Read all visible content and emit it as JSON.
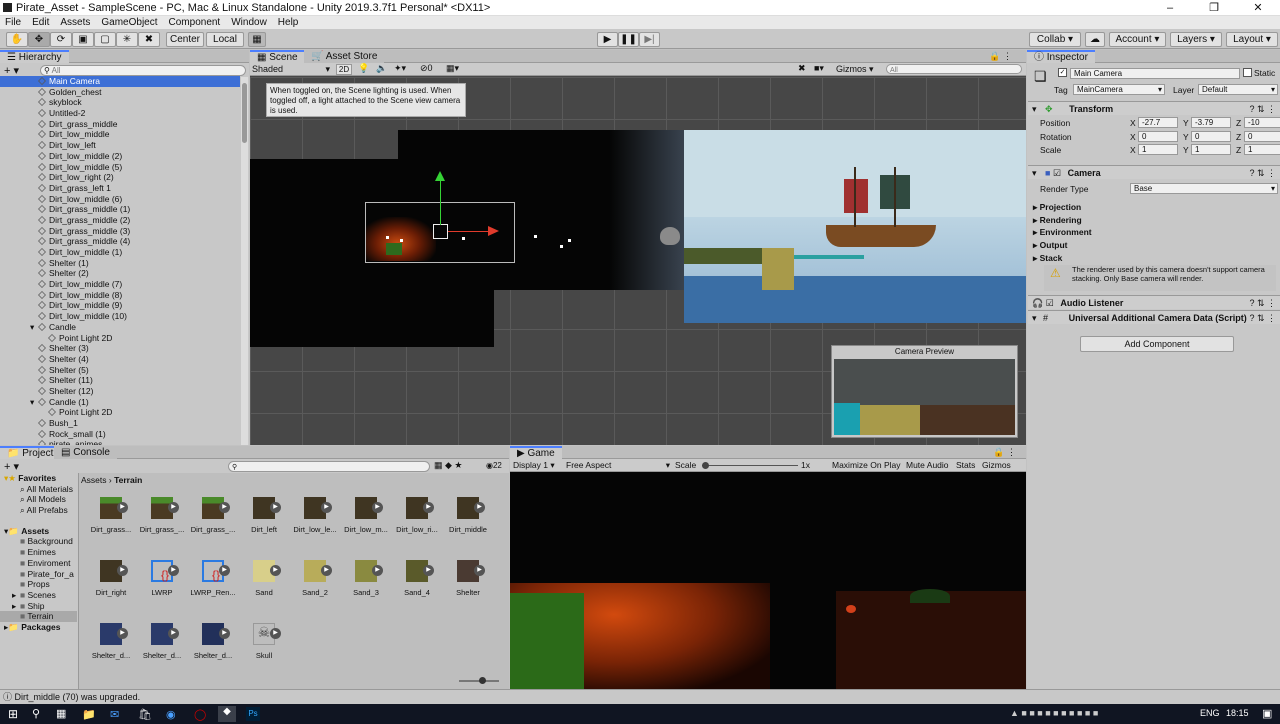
{
  "window": {
    "title": "Pirate_Asset - SampleScene - PC, Mac & Linux Standalone - Unity 2019.3.7f1 Personal* <DX11>"
  },
  "menu": [
    "File",
    "Edit",
    "Assets",
    "GameObject",
    "Component",
    "Window",
    "Help"
  ],
  "toolbar": {
    "center": "Center",
    "local": "Local",
    "collab": "Collab",
    "account": "Account",
    "layers": "Layers",
    "layout": "Layout"
  },
  "hierarchy": {
    "title": "Hierarchy",
    "search_placeholder": "All",
    "items": [
      {
        "label": "Main Camera",
        "indent": 1,
        "selected": true
      },
      {
        "label": "Golden_chest",
        "indent": 1
      },
      {
        "label": "skyblock",
        "indent": 1
      },
      {
        "label": "Untitled-2",
        "indent": 1
      },
      {
        "label": "Dirt_grass_middle",
        "indent": 1
      },
      {
        "label": "Dirt_low_middle",
        "indent": 1
      },
      {
        "label": "Dirt_low_left",
        "indent": 1
      },
      {
        "label": "Dirt_low_middle (2)",
        "indent": 1
      },
      {
        "label": "Dirt_low_middle (5)",
        "indent": 1
      },
      {
        "label": "Dirt_low_right (2)",
        "indent": 1
      },
      {
        "label": "Dirt_grass_left 1",
        "indent": 1
      },
      {
        "label": "Dirt_low_middle (6)",
        "indent": 1
      },
      {
        "label": "Dirt_grass_middle (1)",
        "indent": 1
      },
      {
        "label": "Dirt_grass_middle (2)",
        "indent": 1
      },
      {
        "label": "Dirt_grass_middle (3)",
        "indent": 1
      },
      {
        "label": "Dirt_grass_middle (4)",
        "indent": 1
      },
      {
        "label": "Dirt_low_middle (1)",
        "indent": 1
      },
      {
        "label": "Shelter (1)",
        "indent": 1
      },
      {
        "label": "Shelter (2)",
        "indent": 1
      },
      {
        "label": "Dirt_low_middle (7)",
        "indent": 1
      },
      {
        "label": "Dirt_low_middle (8)",
        "indent": 1
      },
      {
        "label": "Dirt_low_middle (9)",
        "indent": 1
      },
      {
        "label": "Dirt_low_middle (10)",
        "indent": 1
      },
      {
        "label": "Candle",
        "indent": 1,
        "arrow": true
      },
      {
        "label": "Point Light 2D",
        "indent": 2
      },
      {
        "label": "Shelter (3)",
        "indent": 1
      },
      {
        "label": "Shelter (4)",
        "indent": 1
      },
      {
        "label": "Shelter (5)",
        "indent": 1
      },
      {
        "label": "Shelter (11)",
        "indent": 1
      },
      {
        "label": "Shelter (12)",
        "indent": 1
      },
      {
        "label": "Candle (1)",
        "indent": 1,
        "arrow": true
      },
      {
        "label": "Point Light 2D",
        "indent": 2
      },
      {
        "label": "Bush_1",
        "indent": 1
      },
      {
        "label": "Rock_small (1)",
        "indent": 1
      },
      {
        "label": "pirate_animes",
        "indent": 1
      }
    ]
  },
  "scene": {
    "tabs": [
      "Scene",
      "Asset Store"
    ],
    "shading": "Shaded",
    "mode2d": "2D",
    "gizmos": "Gizmos",
    "search_placeholder": "All",
    "light_count": "0",
    "tooltip": "When toggled on, the Scene lighting is used. When toggled off, a light attached to the Scene view camera is used.",
    "camera_preview": "Camera Preview"
  },
  "project": {
    "tabs": [
      "Project",
      "Console"
    ],
    "breadcrumb": [
      "Assets",
      "Terrain"
    ],
    "count": "22",
    "favorites": {
      "title": "Favorites",
      "items": [
        "All Materials",
        "All Models",
        "All Prefabs"
      ]
    },
    "assets": {
      "title": "Assets",
      "items": [
        "Background",
        "Enimes",
        "Enviroment",
        "Pirate_for_a",
        "Props",
        "Scenes",
        "Ship",
        "Terrain"
      ]
    },
    "packages": "Packages",
    "grid": [
      {
        "label": "Dirt_grass...",
        "kind": "grass"
      },
      {
        "label": "Dirt_grass_...",
        "kind": "grass"
      },
      {
        "label": "Dirt_grass_...",
        "kind": "grass"
      },
      {
        "label": "Dirt_left",
        "kind": "dirt"
      },
      {
        "label": "Dirt_low_le...",
        "kind": "dirt"
      },
      {
        "label": "Dirt_low_m...",
        "kind": "dirt"
      },
      {
        "label": "Dirt_low_ri...",
        "kind": "dirt"
      },
      {
        "label": "Dirt_middle",
        "kind": "dirt"
      },
      {
        "label": "Dirt_right",
        "kind": "dirt"
      },
      {
        "label": "LWRP",
        "kind": "cube"
      },
      {
        "label": "LWRP_Ren...",
        "kind": "cube"
      },
      {
        "label": "Sand",
        "kind": "sand"
      },
      {
        "label": "Sand_2",
        "kind": "sand2"
      },
      {
        "label": "Sand_3",
        "kind": "sand3"
      },
      {
        "label": "Sand_4",
        "kind": "sand4"
      },
      {
        "label": "Shelter",
        "kind": "shelter"
      },
      {
        "label": "Shelter_d...",
        "kind": "blue"
      },
      {
        "label": "Shelter_d...",
        "kind": "blue"
      },
      {
        "label": "Shelter_d...",
        "kind": "blue2"
      },
      {
        "label": "Skull",
        "kind": "skull"
      }
    ]
  },
  "game": {
    "tab": "Game",
    "display": "Display 1",
    "aspect": "Free Aspect",
    "scale_label": "Scale",
    "scale_value": "1x",
    "buttons": [
      "Maximize On Play",
      "Mute Audio",
      "Stats",
      "Gizmos"
    ]
  },
  "inspector": {
    "title": "Inspector",
    "object_name": "Main Camera",
    "static_label": "Static",
    "tag_label": "Tag",
    "tag": "MainCamera",
    "layer_label": "Layer",
    "layer": "Default",
    "transform": {
      "title": "Transform",
      "rows": [
        {
          "label": "Position",
          "x": "-27.7",
          "y": "-3.79",
          "z": "-10"
        },
        {
          "label": "Rotation",
          "x": "0",
          "y": "0",
          "z": "0"
        },
        {
          "label": "Scale",
          "x": "1",
          "y": "1",
          "z": "1"
        }
      ]
    },
    "camera": {
      "title": "Camera",
      "render_type_label": "Render Type",
      "render_type": "Base",
      "sections": [
        "Projection",
        "Rendering",
        "Environment",
        "Output",
        "Stack"
      ],
      "warning": "The renderer used by this camera doesn't support camera stacking. Only Base camera will render."
    },
    "audio_listener": "Audio Listener",
    "ucad": "Universal Additional Camera Data (Script)",
    "add_component": "Add Component"
  },
  "status": "Dirt_middle (70) was upgraded.",
  "taskbar": {
    "lang": "ENG",
    "time": "18:15"
  },
  "colors": {
    "accent": "#4c7efe",
    "selection": "#3d6fd6",
    "sky": "#c9dde6",
    "sea": "#3a6ea5",
    "dark": "#050505"
  }
}
